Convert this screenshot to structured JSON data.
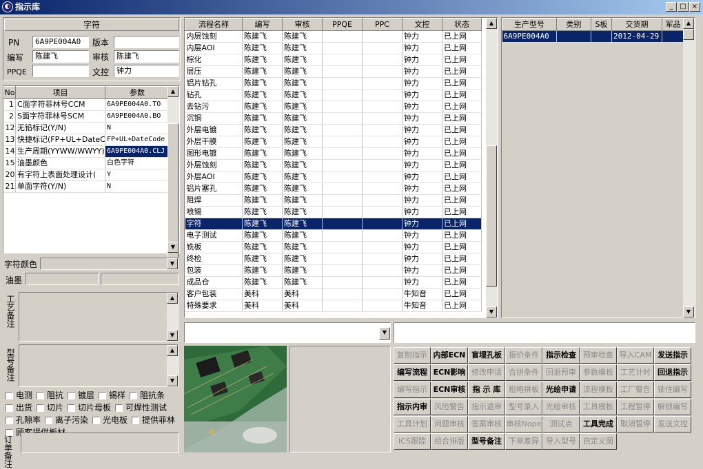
{
  "window": {
    "title": "指示库",
    "min": "_",
    "max": "□",
    "close": "×"
  },
  "char_panel": {
    "header": "字符",
    "pn_label": "PN",
    "pn_value": "6A9PE004A0",
    "version_label": "版本",
    "version_value": "",
    "writer_label": "编写",
    "writer_value": "陈建飞",
    "review_label": "审核",
    "review_value": "陈建飞",
    "ppqe_label": "PPQE",
    "ppqe_value": "",
    "doc_label": "文控",
    "doc_value": "钟力"
  },
  "param_table": {
    "headers": [
      "No",
      "项目",
      "参数"
    ],
    "rows": [
      [
        "1",
        "C面字符菲林号CCM",
        "6A9PE004A0.TO"
      ],
      [
        "2",
        "S面字符菲林号SCM",
        "6A9PE004A0.BO"
      ],
      [
        "12",
        "无铅标记(Y/N)",
        "N"
      ],
      [
        "13",
        "快捷标记(FP+UL+DateCo",
        "FP+UL+DateCode"
      ],
      [
        "14",
        "生产周期(YYWW/WWYY)",
        "6A9PE004A0.CLJ"
      ],
      [
        "15",
        "油墨颜色",
        "白色字符"
      ],
      [
        "20",
        "有字符上表面处理设计(",
        "Y"
      ],
      [
        "21",
        "单面字符(Y/N)",
        "N"
      ]
    ]
  },
  "char_color_label": "字符颜色",
  "ink_label": "油墨",
  "remarks": {
    "craft_label": "工艺备注",
    "model_label": "型号备注",
    "order_label": "订单备注"
  },
  "checkboxes": [
    [
      "电测",
      "阻抗",
      "镀层",
      "锡样",
      "阻抗条"
    ],
    [
      "出货",
      "切片",
      "切片母板",
      "可焊性测试"
    ],
    [
      "孔隙率",
      "离子污染",
      "光电板",
      "提供菲林"
    ],
    [
      "顾客提供板材"
    ]
  ],
  "flow_table": {
    "headers": [
      "流程名称",
      "编写",
      "审核",
      "PPQE",
      "PPC",
      "文控",
      "状态"
    ],
    "rows": [
      [
        "内层蚀刻",
        "陈建飞",
        "陈建飞",
        "",
        "",
        "钟力",
        "已上网"
      ],
      [
        "内层AOI",
        "陈建飞",
        "陈建飞",
        "",
        "",
        "钟力",
        "已上网"
      ],
      [
        "棕化",
        "陈建飞",
        "陈建飞",
        "",
        "",
        "钟力",
        "已上网"
      ],
      [
        "层压",
        "陈建飞",
        "陈建飞",
        "",
        "",
        "钟力",
        "已上网"
      ],
      [
        "铝片钻孔",
        "陈建飞",
        "陈建飞",
        "",
        "",
        "钟力",
        "已上网"
      ],
      [
        "钻孔",
        "陈建飞",
        "陈建飞",
        "",
        "",
        "钟力",
        "已上网"
      ],
      [
        "去钻污",
        "陈建飞",
        "陈建飞",
        "",
        "",
        "钟力",
        "已上网"
      ],
      [
        "沉铜",
        "陈建飞",
        "陈建飞",
        "",
        "",
        "钟力",
        "已上网"
      ],
      [
        "外层电镀",
        "陈建飞",
        "陈建飞",
        "",
        "",
        "钟力",
        "已上网"
      ],
      [
        "外层干膜",
        "陈建飞",
        "陈建飞",
        "",
        "",
        "钟力",
        "已上网"
      ],
      [
        "图形电镀",
        "陈建飞",
        "陈建飞",
        "",
        "",
        "钟力",
        "已上网"
      ],
      [
        "外层蚀刻",
        "陈建飞",
        "陈建飞",
        "",
        "",
        "钟力",
        "已上网"
      ],
      [
        "外层AOI",
        "陈建飞",
        "陈建飞",
        "",
        "",
        "钟力",
        "已上网"
      ],
      [
        "铝片塞孔",
        "陈建飞",
        "陈建飞",
        "",
        "",
        "钟力",
        "已上网"
      ],
      [
        "阻焊",
        "陈建飞",
        "陈建飞",
        "",
        "",
        "钟力",
        "已上网"
      ],
      [
        "喷锡",
        "陈建飞",
        "陈建飞",
        "",
        "",
        "钟力",
        "已上网"
      ],
      [
        "字符",
        "陈建飞",
        "陈建飞",
        "",
        "",
        "钟力",
        "已上网"
      ],
      [
        "电子测试",
        "陈建飞",
        "陈建飞",
        "",
        "",
        "钟力",
        "已上网"
      ],
      [
        "铣板",
        "陈建飞",
        "陈建飞",
        "",
        "",
        "钟力",
        "已上网"
      ],
      [
        "终检",
        "陈建飞",
        "陈建飞",
        "",
        "",
        "钟力",
        "已上网"
      ],
      [
        "包装",
        "陈建飞",
        "陈建飞",
        "",
        "",
        "钟力",
        "已上网"
      ],
      [
        "成品仓",
        "陈建飞",
        "陈建飞",
        "",
        "",
        "钟力",
        "已上网"
      ],
      [
        "客户包装",
        "美科",
        "美科",
        "",
        "",
        "牛知音",
        "已上网"
      ],
      [
        "特殊要求",
        "美科",
        "美科",
        "",
        "",
        "牛知音",
        "已上网"
      ]
    ],
    "selected": 16
  },
  "model_table": {
    "headers": [
      "生产型号",
      "类别",
      "S板",
      "交货期",
      "军品"
    ],
    "rows": [
      [
        "6A9PE004A0",
        "",
        "",
        "2012-04-29",
        ""
      ]
    ]
  },
  "buttons": [
    [
      [
        "复制指示",
        false
      ],
      [
        "内部ECN",
        true
      ],
      [
        "盲埋孔板",
        true
      ],
      [
        "报价条件",
        false
      ],
      [
        "指示检查",
        true
      ],
      [
        "预审检查",
        false
      ],
      [
        "导入CAM",
        false
      ],
      [
        "发送指示",
        true
      ]
    ],
    [
      [
        "编写流程",
        true
      ],
      [
        "ECN影响",
        true
      ],
      [
        "修改申请",
        false
      ],
      [
        "合拼条件",
        false
      ],
      [
        "回退预审",
        false
      ],
      [
        "参数模板",
        false
      ],
      [
        "工艺计时",
        false
      ],
      [
        "回退指示",
        true
      ]
    ],
    [
      [
        "编写指示",
        false
      ],
      [
        "ECN审核",
        true
      ],
      [
        "指 示 库",
        true
      ],
      [
        "粗略拼板",
        false
      ],
      [
        "光绘申请",
        true
      ],
      [
        "流程模板",
        false
      ],
      [
        "工厂警告",
        false
      ],
      [
        "锁住编写",
        false
      ]
    ],
    [
      [
        "指示内审",
        true
      ],
      [
        "风险警告",
        false
      ],
      [
        "指示退审",
        false
      ],
      [
        "型号录入",
        false
      ],
      [
        "光绘审核",
        false
      ],
      [
        "工具模板",
        false
      ],
      [
        "工程暂停",
        false
      ],
      [
        "解锁编写",
        false
      ]
    ],
    [
      [
        "工具计划",
        false
      ],
      [
        "问题审核",
        false
      ],
      [
        "答案审核",
        false
      ],
      [
        "审核Nope",
        false
      ],
      [
        "测试点",
        false
      ],
      [
        "工具完成",
        true
      ],
      [
        "取消暂停",
        false
      ],
      [
        "发送文控",
        false
      ]
    ],
    [
      [
        "ICS跟踪",
        false
      ],
      [
        "组合排版",
        false
      ],
      [
        "型号备注",
        true
      ],
      [
        "下单差异",
        false
      ],
      [
        "导入型号",
        false
      ],
      [
        "自定义图",
        false
      ]
    ]
  ]
}
